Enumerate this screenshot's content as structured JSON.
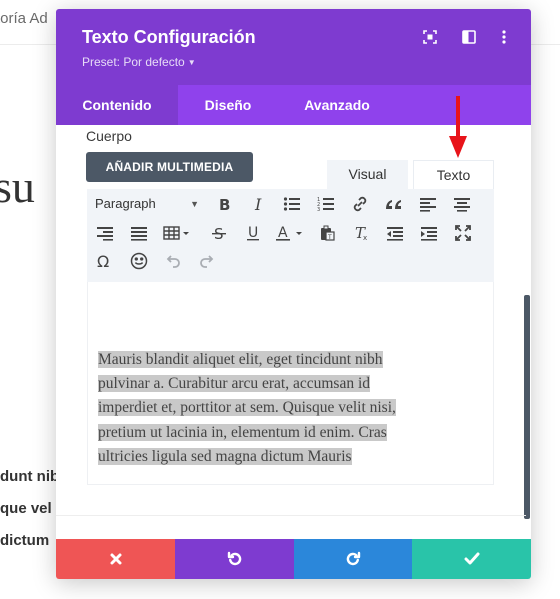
{
  "background": {
    "header_text": "toría Ad",
    "heading": "su",
    "lines": [
      "dunt nib",
      "que vel",
      "dictum"
    ]
  },
  "modal": {
    "title": "Texto Configuración",
    "preset": "Preset: Por defecto",
    "header_icons": [
      "focus-icon",
      "split-view-icon",
      "more-vertical-icon"
    ],
    "tabs": [
      {
        "label": "Contenido",
        "active": true
      },
      {
        "label": "Diseño",
        "active": false
      },
      {
        "label": "Avanzado",
        "active": false
      }
    ],
    "field_label": "Cuerpo",
    "media_button": "AÑADIR MULTIMEDIA",
    "editor_tabs": {
      "visual": "Visual",
      "text": "Texto"
    },
    "toolbar": {
      "paragraph": "Paragraph",
      "row1": [
        "bold-icon",
        "italic-icon",
        "bullet-list-icon",
        "numbered-list-icon",
        "link-icon",
        "blockquote-icon",
        "align-left-icon",
        "align-center-icon"
      ],
      "row2": [
        "align-right-icon",
        "justify-icon",
        "table-icon",
        "strikethrough-icon",
        "underline-icon",
        "text-color-icon",
        "paste-text-icon",
        "clear-format-icon",
        "outdent-icon",
        "indent-icon",
        "fullscreen-icon"
      ],
      "row3": [
        "special-char-icon",
        "emoji-icon",
        "undo-icon",
        "redo-icon"
      ]
    },
    "content_lines": [
      "Mauris blandit aliquet elit, eget tincidunt nibh",
      "pulvinar a. Curabitur arcu erat, accumsan id",
      "imperdiet et, porttitor at sem. Quisque velit nisi,",
      "pretium ut lacinia in, elementum id enim. Cras",
      "ultricies ligula sed magna dictum Mauris"
    ],
    "footer": [
      {
        "icon": "close-icon",
        "color": "#ef5555"
      },
      {
        "icon": "undo-icon",
        "color": "#7e3bd0"
      },
      {
        "icon": "redo-icon",
        "color": "#2b87da"
      },
      {
        "icon": "check-icon",
        "color": "#29c4a9"
      }
    ]
  },
  "colors": {
    "header": "#7e3bd0",
    "tabs_bar": "#8f42ec",
    "arrow": "#e8141a"
  }
}
